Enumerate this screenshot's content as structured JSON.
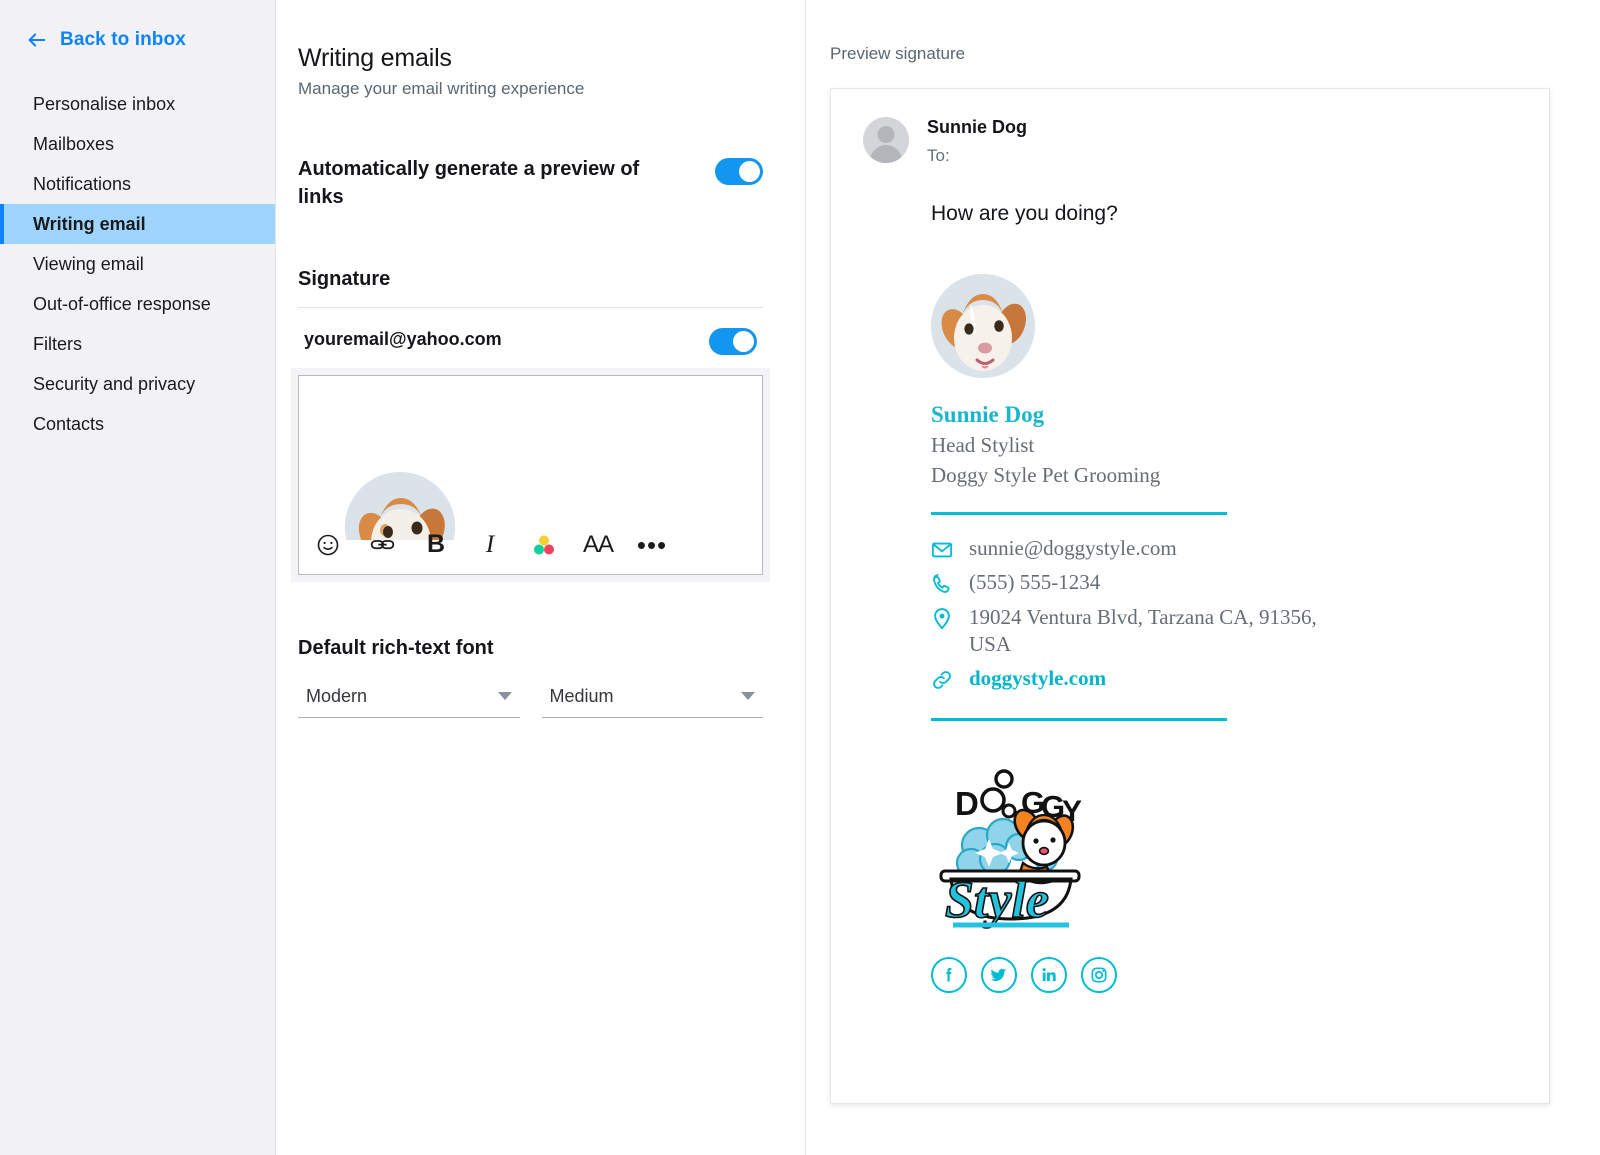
{
  "sidebar": {
    "back_label": "Back to inbox",
    "back_icon": "arrow-left-icon",
    "items": [
      {
        "label": "Personalise inbox",
        "active": false
      },
      {
        "label": "Mailboxes",
        "active": false
      },
      {
        "label": "Notifications",
        "active": false
      },
      {
        "label": "Writing email",
        "active": true
      },
      {
        "label": "Viewing email",
        "active": false
      },
      {
        "label": "Out-of-office response",
        "active": false
      },
      {
        "label": "Filters",
        "active": false
      },
      {
        "label": "Security and privacy",
        "active": false
      },
      {
        "label": "Contacts",
        "active": false
      }
    ]
  },
  "settings": {
    "title": "Writing emails",
    "subtitle": "Manage your email writing experience",
    "link_preview": {
      "label": "Automatically generate a preview of links",
      "toggle_state": "on"
    },
    "signature": {
      "section_title": "Signature",
      "account_email": "youremail@yahoo.com",
      "toggle_state": "on",
      "toolbar": [
        {
          "name": "emoji-icon",
          "glyph": "emoji"
        },
        {
          "name": "link-icon",
          "glyph": "link"
        },
        {
          "name": "bold-icon",
          "glyph": "B"
        },
        {
          "name": "italic-icon",
          "glyph": "I"
        },
        {
          "name": "text-color-icon",
          "glyph": "color-dots"
        },
        {
          "name": "font-size-icon",
          "glyph": "AA"
        },
        {
          "name": "more-options-icon",
          "glyph": "•••"
        }
      ]
    },
    "font": {
      "section_title": "Default rich-text font",
      "family_value": "Modern",
      "size_value": "Medium"
    }
  },
  "preview": {
    "title": "Preview signature",
    "email": {
      "from": "Sunnie Dog",
      "to_label": "To:",
      "body": "How are you doing?"
    },
    "signature": {
      "name": "Sunnie Dog",
      "role": "Head Stylist",
      "company": "Doggy Style Pet Grooming",
      "contacts": [
        {
          "icon": "envelope-icon",
          "text": "sunnie@doggystyle.com",
          "is_link": false
        },
        {
          "icon": "phone-icon",
          "text": "(555) 555-1234",
          "is_link": false
        },
        {
          "icon": "location-pin-icon",
          "text": "19024 Ventura Blvd, Tarzana CA, 91356, USA",
          "is_link": false
        },
        {
          "icon": "link-chain-icon",
          "text": "doggystyle.com",
          "is_link": true
        }
      ],
      "logo": {
        "word_top": "DOGGY",
        "word_bottom": "Style"
      },
      "socials": [
        {
          "name": "facebook-icon",
          "label": "f"
        },
        {
          "name": "twitter-icon",
          "label": "twitter"
        },
        {
          "name": "linkedin-icon",
          "label": "in"
        },
        {
          "name": "instagram-icon",
          "label": "instagram"
        }
      ]
    }
  },
  "colors": {
    "accent_blue": "#1296f0",
    "link_blue": "#0f84fa",
    "active_nav_bg": "#9ed4fd",
    "signature_cyan": "#00bcd4",
    "sidebar_bg": "#f2f2f5"
  }
}
